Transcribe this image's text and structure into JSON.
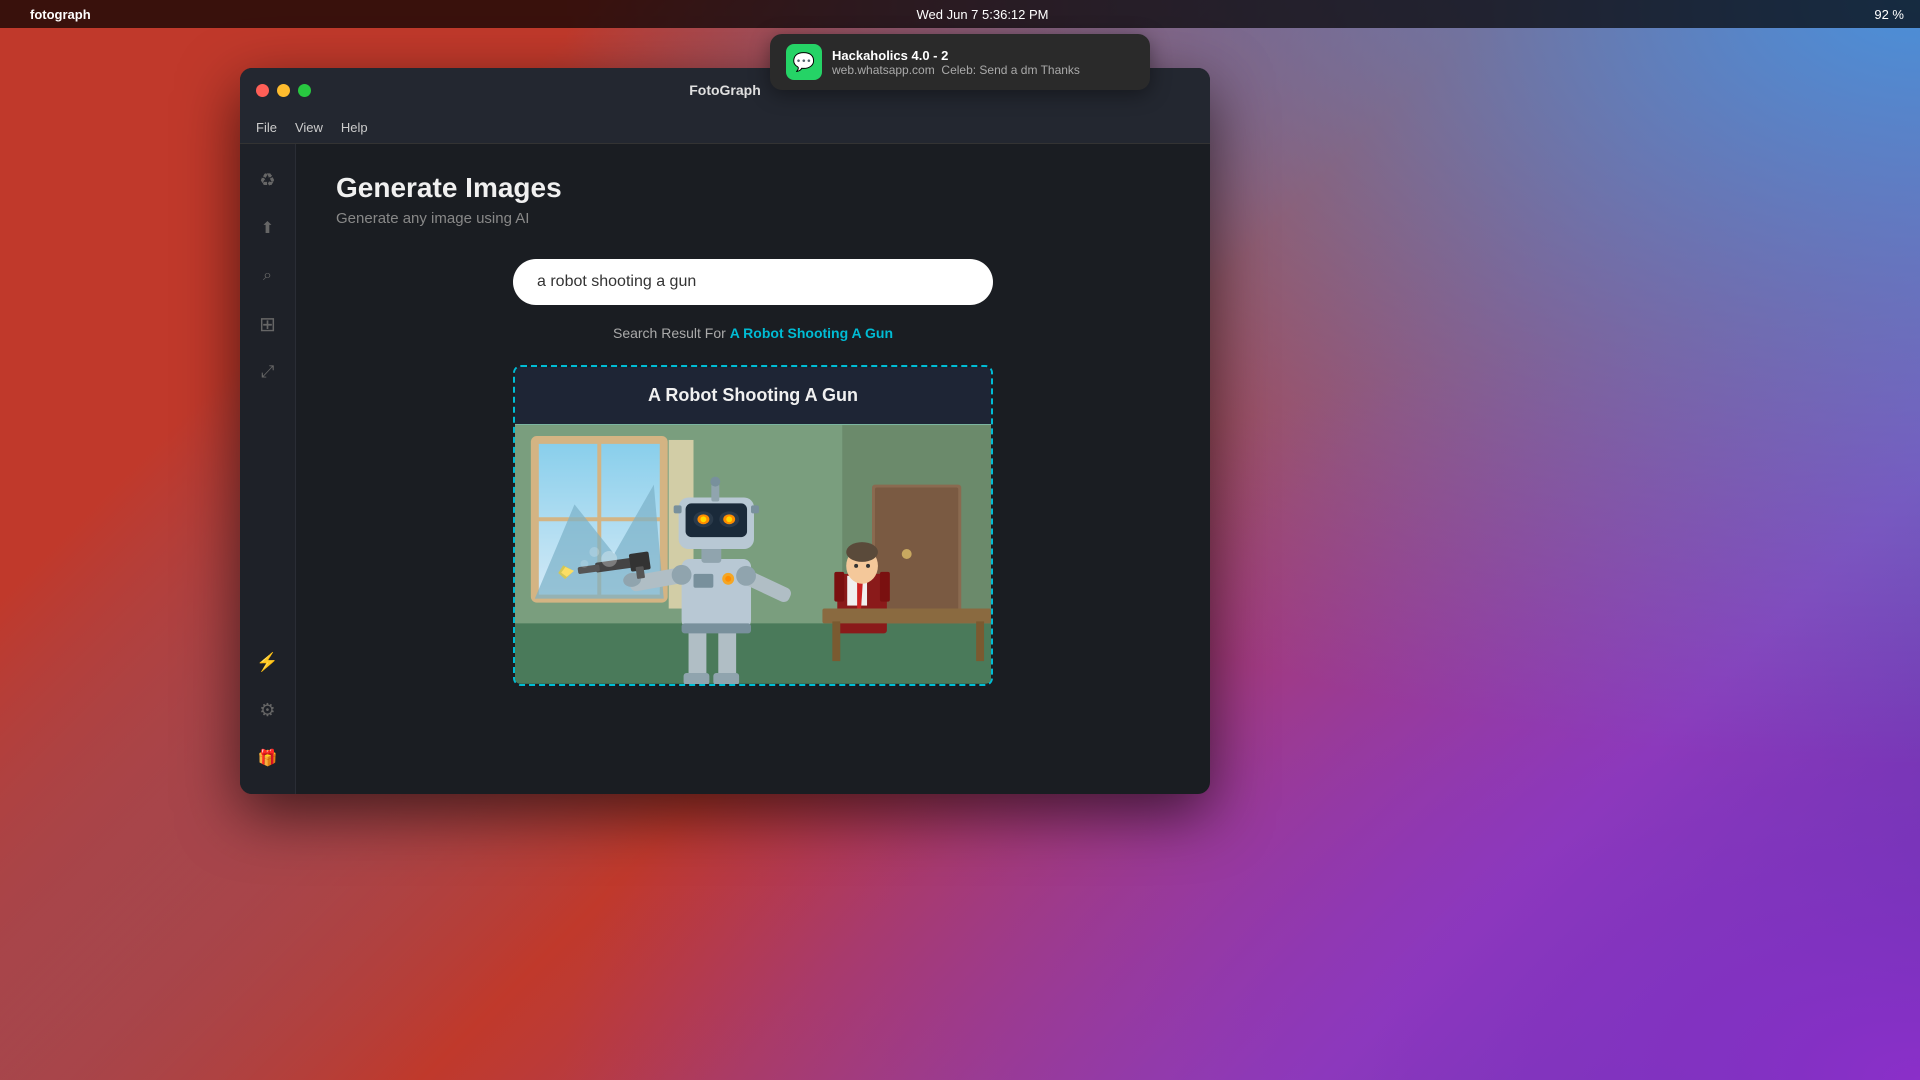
{
  "desktop": {
    "bg_description": "macOS Big Sur gradient wallpaper"
  },
  "menubar": {
    "apple_symbol": "",
    "app_name": "fotograph",
    "date_time": "Wed Jun 7   5:36:12 PM",
    "battery": "92 %"
  },
  "notification": {
    "app": "Hackaholics 4.0 - 2",
    "source": "web.whatsapp.com",
    "message": "Celeb: Send a dm Thanks"
  },
  "window": {
    "title": "FotoGraph",
    "menu_items": [
      "File",
      "View",
      "Help"
    ]
  },
  "sidebar": {
    "icons": [
      {
        "name": "recycle-icon",
        "symbol": "♻",
        "active": false
      },
      {
        "name": "upload-icon",
        "symbol": "⬆",
        "active": false
      },
      {
        "name": "search-icon",
        "symbol": "⌕",
        "active": false
      },
      {
        "name": "grid-icon",
        "symbol": "⊞",
        "active": false
      },
      {
        "name": "compress-icon",
        "symbol": "⤢",
        "active": false
      },
      {
        "name": "bolt-icon",
        "symbol": "⚡",
        "active": true
      },
      {
        "name": "settings-icon",
        "symbol": "⚙",
        "active": false
      },
      {
        "name": "gift-icon",
        "symbol": "🎁",
        "active": false
      }
    ]
  },
  "page": {
    "title": "Generate Images",
    "subtitle": "Generate any image using AI",
    "search_value": "a robot shooting a gun",
    "search_placeholder": "a robot shooting a gun",
    "search_result_prefix": "Search Result For",
    "search_result_query": "A Robot Shooting A Gun",
    "result_card_title": "A Robot Shooting A Gun"
  }
}
